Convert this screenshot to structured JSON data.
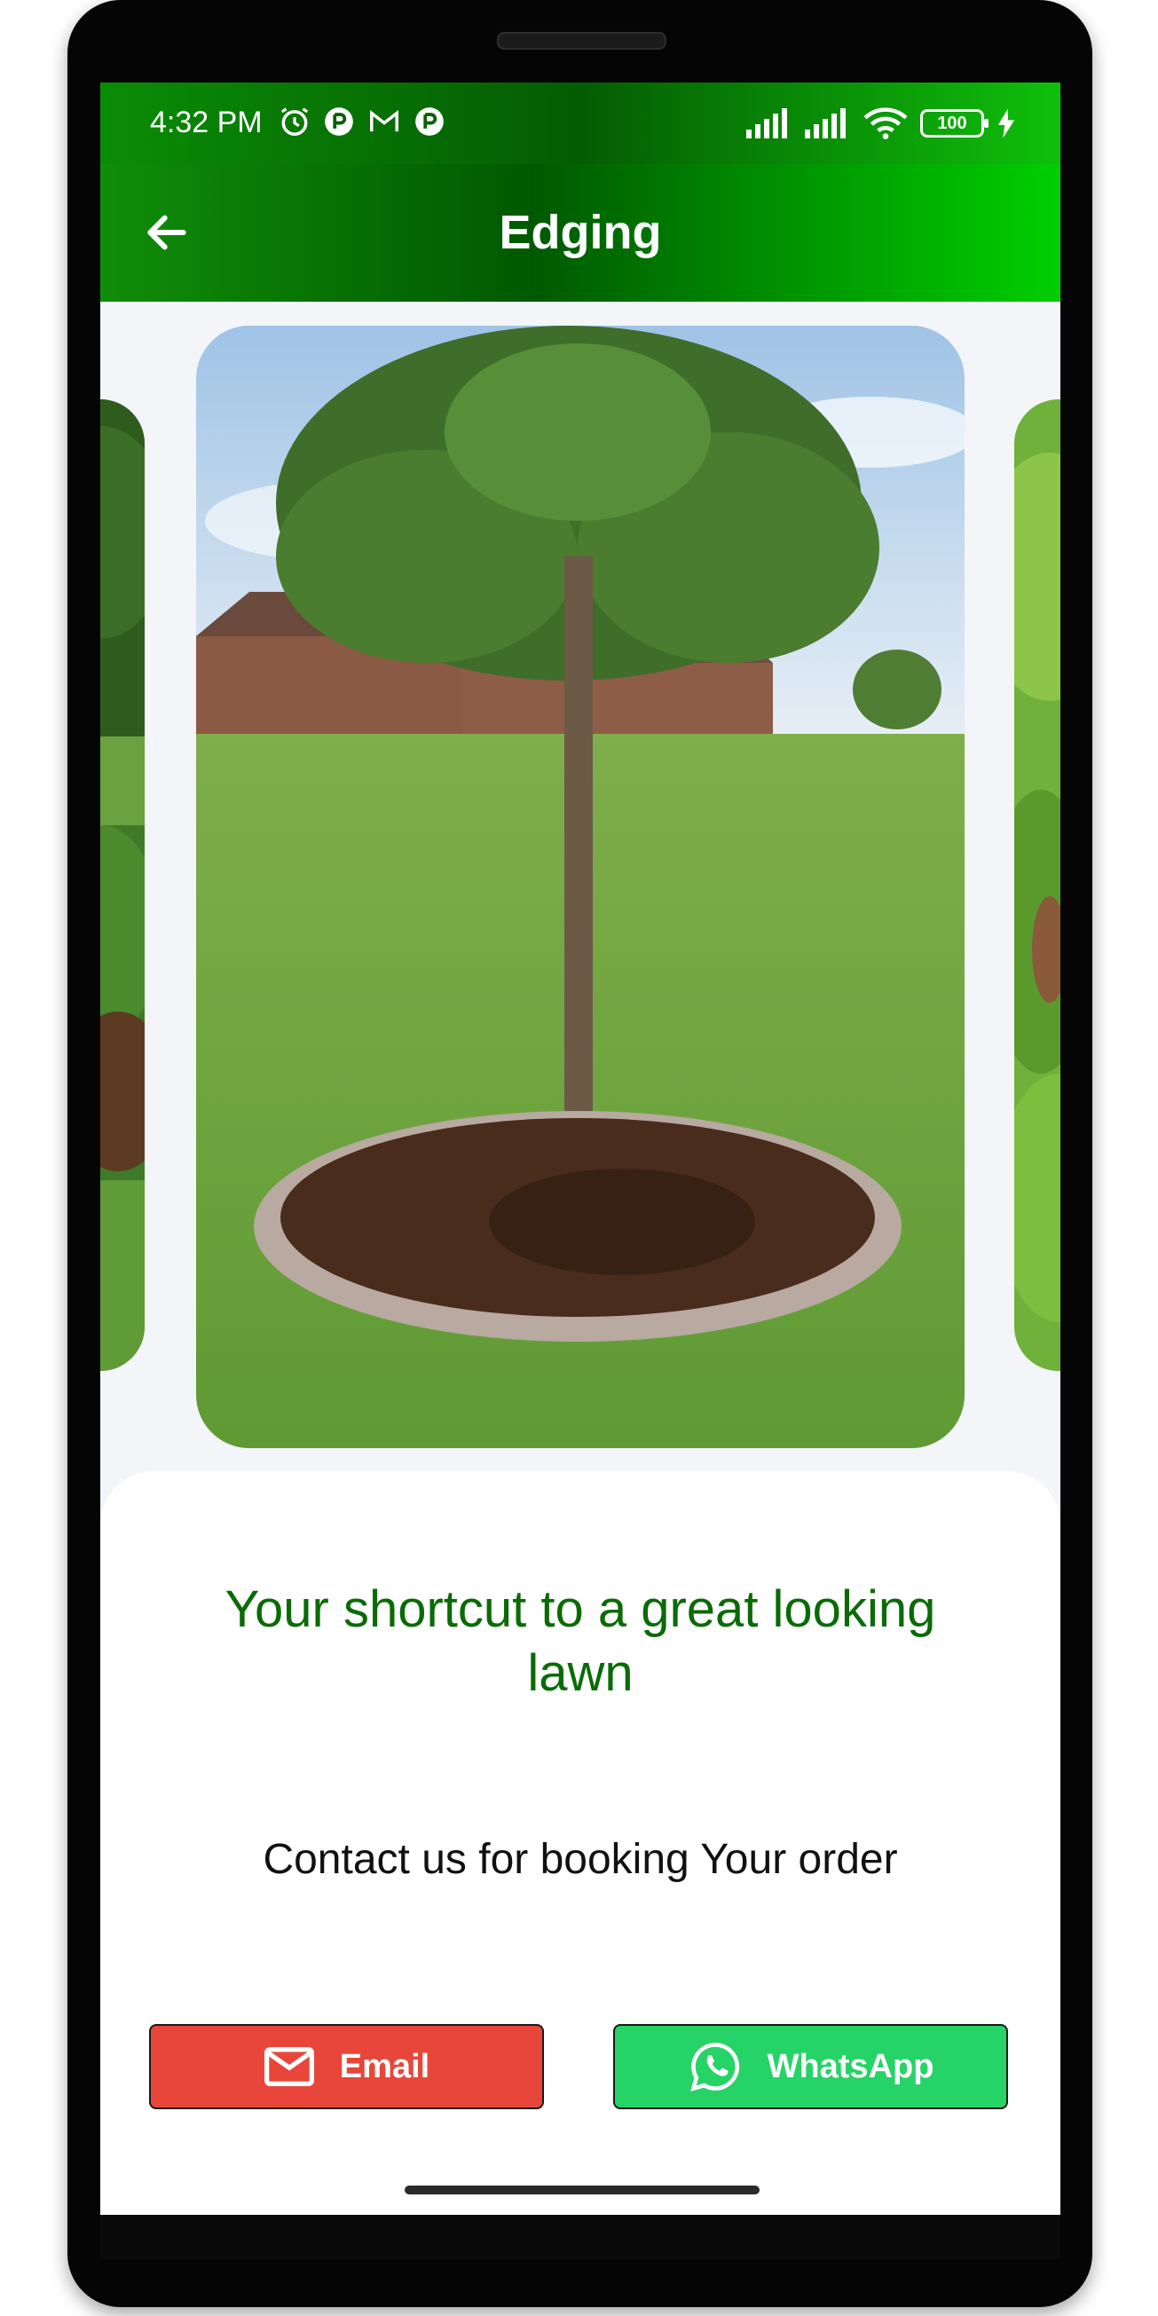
{
  "status_bar": {
    "time": "4:32 PM",
    "left_icons": [
      "alarm-icon",
      "notification-p-icon",
      "gmail-icon",
      "notification-p2-icon"
    ],
    "right_icons": [
      "signal-icon",
      "signal-2-icon",
      "wifi-icon",
      "battery-icon",
      "charging-icon"
    ],
    "battery_level": "100"
  },
  "app_bar": {
    "back_icon": "back-arrow-icon",
    "title": "Edging"
  },
  "carousel": {
    "current_image": "tree-with-concrete-edging-photo",
    "adjacent_left": "garden-photo-left",
    "adjacent_right": "garden-photo-right"
  },
  "content": {
    "tagline": "Your shortcut to a great looking lawn",
    "contact_text": "Contact us for booking Your order"
  },
  "buttons": {
    "email_label": "Email",
    "whatsapp_label": "WhatsApp"
  },
  "colors": {
    "app_bar_green": "#005900",
    "tagline_green": "#0a6b06",
    "email_red": "#e8463a",
    "whatsapp_green": "#26d366"
  }
}
